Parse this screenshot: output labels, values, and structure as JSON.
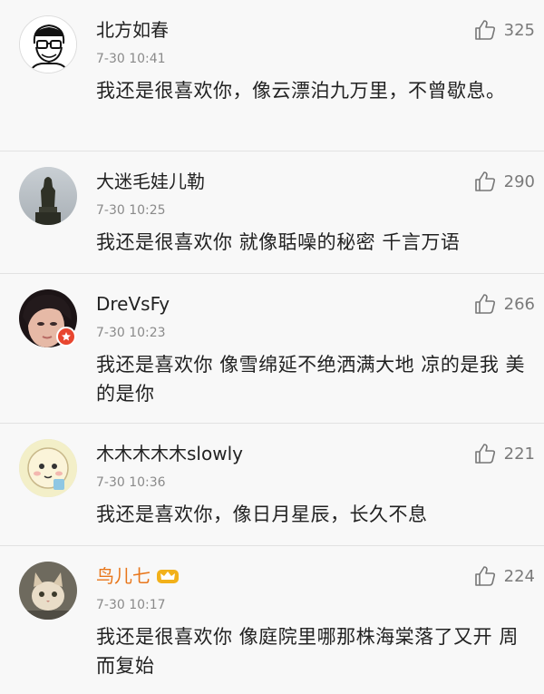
{
  "comments": [
    {
      "username": "北方如春",
      "time": "7-30 10:41",
      "likes": "325",
      "text": "我还是很喜欢你，像云漂泊九万里，不曾歇息。",
      "avatar_icon": "glasses-man-sketch-avatar"
    },
    {
      "username": "大迷毛娃儿勒",
      "time": "7-30 10:25",
      "likes": "290",
      "text": "我还是很喜欢你 就像聒噪的秘密 千言万语",
      "avatar_icon": "statue-avatar"
    },
    {
      "username": "DreVsFy",
      "time": "7-30 10:23",
      "likes": "266",
      "text": "我还是喜欢你 像雪绵延不绝洒满大地 凉的是我 美的是你",
      "avatar_icon": "girl-photo-avatar"
    },
    {
      "username": "木木木木木slowly",
      "time": "7-30 10:36",
      "likes": "221",
      "text": "我还是喜欢你，像日月星辰，长久不息",
      "avatar_icon": "cartoon-face-avatar"
    },
    {
      "username": "鸟儿七",
      "time": "7-30 10:17",
      "likes": "224",
      "text": "我还是很喜欢你 像庭院里哪那株海棠落了又开 周而复始",
      "avatar_icon": "cat-photo-avatar",
      "vip_color": "#e8761a"
    }
  ]
}
